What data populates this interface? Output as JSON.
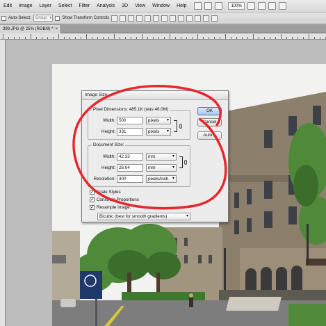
{
  "menubar": {
    "items": [
      "Edit",
      "Image",
      "Layer",
      "Select",
      "Filter",
      "Analysis",
      "3D",
      "View",
      "Window",
      "Help"
    ],
    "zoom": "100%"
  },
  "options_bar": {
    "auto_select_label": "Auto-Select:",
    "auto_select_value": "Group",
    "show_transform_label": "Show Transform Controls"
  },
  "document_tab": {
    "title": "399.JPG @ 25% (RGB/8) *",
    "close": "×"
  },
  "dialog": {
    "title": "Image Size",
    "pixel_dimensions": {
      "label": "Pixel Dimensions:",
      "size": "485.1K (was 46.0M)",
      "width_label": "Width:",
      "width_value": "500",
      "width_unit": "pixels",
      "height_label": "Height:",
      "height_value": "331",
      "height_unit": "pixels"
    },
    "document_size": {
      "label": "Document Size:",
      "width_label": "Width:",
      "width_value": "42.33",
      "width_unit": "mm",
      "height_label": "Height:",
      "height_value": "28.04",
      "height_unit": "mm",
      "resolution_label": "Resolution:",
      "resolution_value": "300",
      "resolution_unit": "pixels/inch"
    },
    "buttons": {
      "ok": "OK",
      "cancel": "Cancel",
      "auto": "Auto..."
    },
    "checkboxes": {
      "scale_styles": {
        "label": "Scale Styles",
        "checked": true
      },
      "constrain": {
        "label": "Constrain Proportions",
        "checked": true
      },
      "resample": {
        "label": "Resample Image:",
        "checked": true
      }
    },
    "resample_method": "Bicubic (best for smooth gradients)"
  },
  "colors": {
    "annotation": "#e8262b",
    "sky": "#f3f3f3",
    "building": "#8a7d6a",
    "tree": "#4f8a3a"
  }
}
